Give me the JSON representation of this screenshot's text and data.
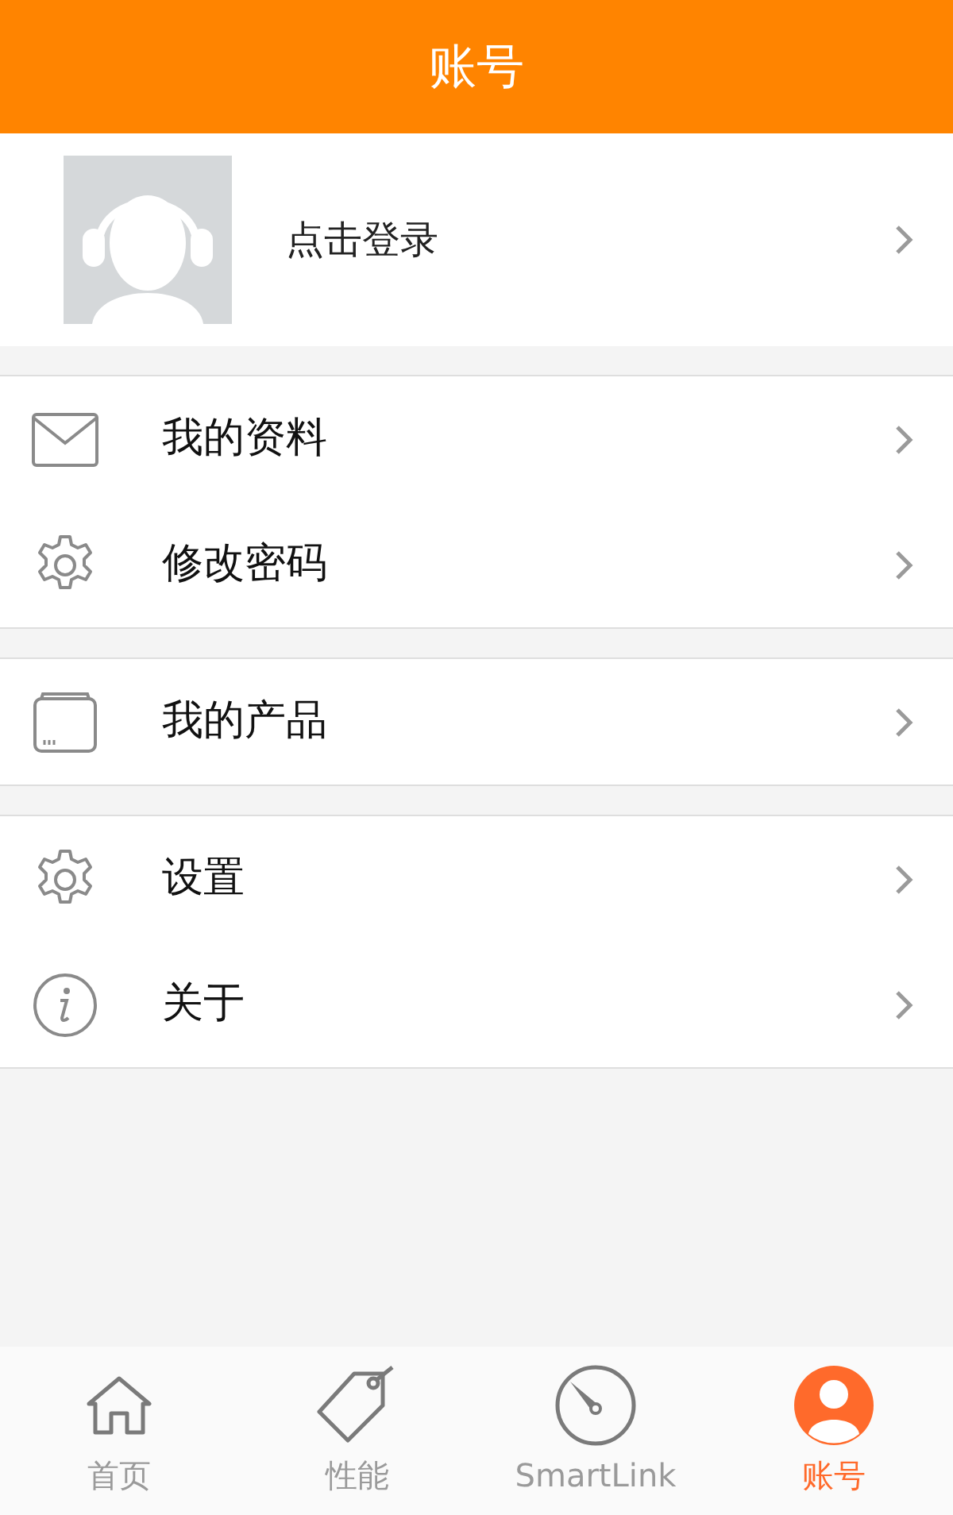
{
  "header": {
    "title": "账号"
  },
  "profile": {
    "label": "点击登录"
  },
  "menu_groups": [
    {
      "items": [
        {
          "kind": "mail",
          "label": "我的资料"
        },
        {
          "kind": "gear",
          "label": "修改密码"
        }
      ]
    },
    {
      "items": [
        {
          "kind": "box",
          "label": "我的产品"
        }
      ]
    },
    {
      "items": [
        {
          "kind": "gear",
          "label": "设置"
        },
        {
          "kind": "info",
          "label": "关于"
        }
      ]
    }
  ],
  "tabs": [
    {
      "kind": "home",
      "label": "首页",
      "selected": false
    },
    {
      "kind": "tag",
      "label": "性能",
      "selected": false
    },
    {
      "kind": "gauge",
      "label": "SmartLink",
      "selected": false
    },
    {
      "kind": "user",
      "label": "账号",
      "selected": true
    }
  ]
}
